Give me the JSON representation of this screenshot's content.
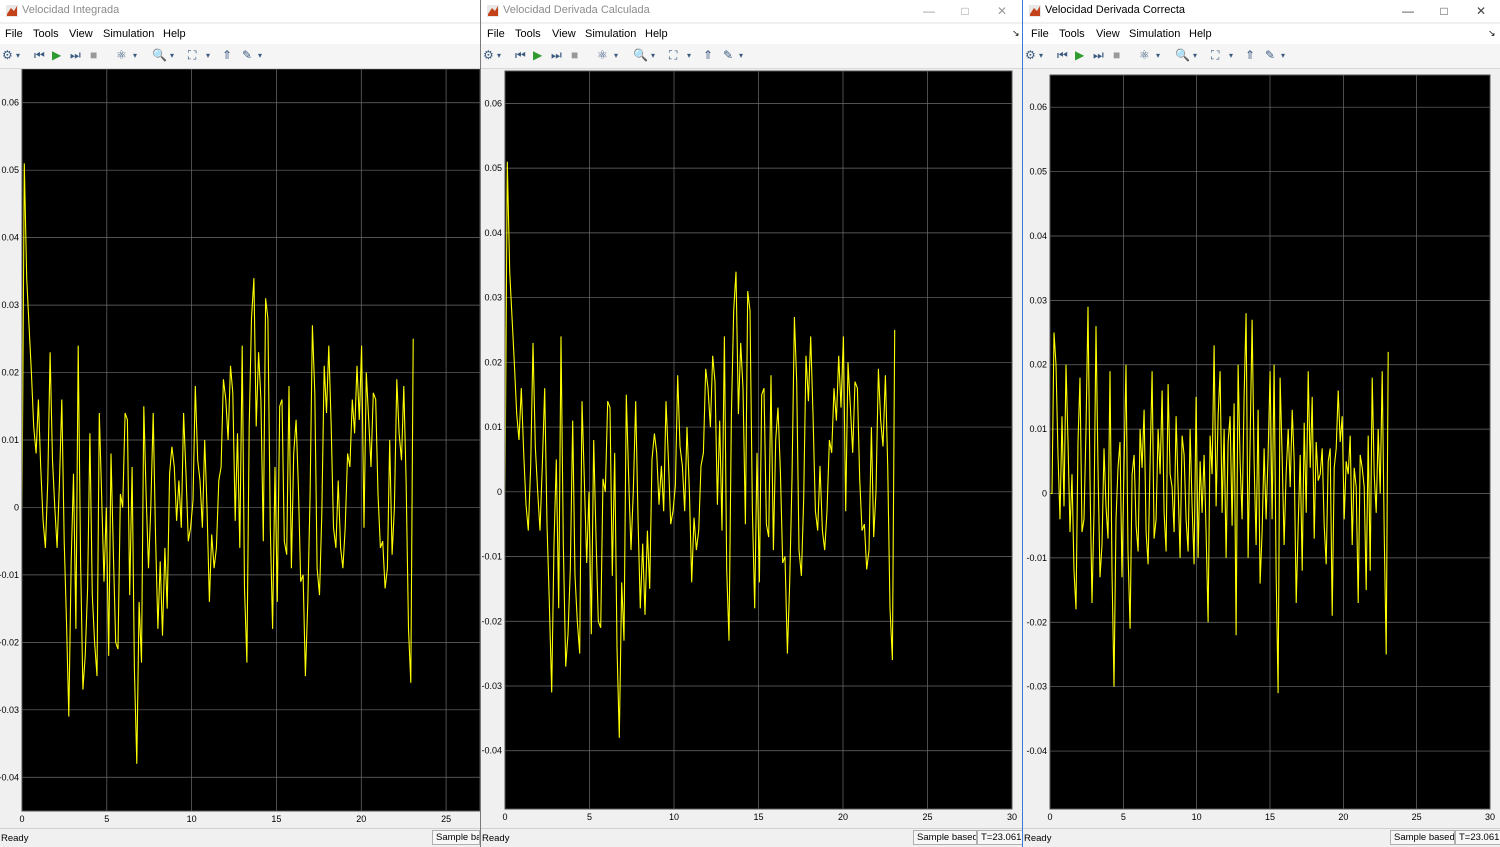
{
  "menu": [
    "File",
    "Tools",
    "View",
    "Simulation",
    "Help"
  ],
  "windows": [
    {
      "title": "Velocidad Integrada",
      "status": "Ready",
      "sample": "Sample based",
      "time": ""
    },
    {
      "title": "Velocidad Derivada Calculada",
      "status": "Ready",
      "sample": "Sample based",
      "time": "T=23.061"
    },
    {
      "title": "Velocidad Derivada Correcta",
      "status": "Ready",
      "sample": "Sample based",
      "time": "T=23.061"
    }
  ],
  "colors": {
    "plot_bg": "#000000",
    "grid": "#6e6e6e",
    "line": "#ffff00",
    "axis_text": "#ffffff"
  },
  "chart_data": [
    {
      "type": "line",
      "ylim": [
        -0.045,
        0.065
      ],
      "xlim": [
        0,
        27
      ],
      "yticks": [
        "-0.04",
        "-0.03",
        "-0.02",
        "-0.01",
        "0",
        "0.01",
        "0.02",
        "0.03",
        "0.04",
        "0.05",
        "0.06"
      ],
      "xticks": [
        "0",
        "5",
        "10",
        "15",
        "20",
        "25"
      ],
      "series": [
        {
          "x_end": 23.06,
          "values": [
            0,
            0.051,
            0.034,
            0.027,
            0.02,
            0.012,
            0.008,
            0.016,
            0.006,
            -0.002,
            -0.006,
            0.004,
            0.023,
            0.007,
            0.0,
            -0.006,
            0.004,
            0.016,
            -0.005,
            -0.017,
            -0.031,
            -0.008,
            0.005,
            -0.018,
            0.024,
            -0.008,
            -0.027,
            -0.022,
            -0.012,
            0.011,
            -0.013,
            -0.02,
            -0.025,
            0.014,
            0.002,
            -0.011,
            0.0,
            -0.022,
            0.008,
            -0.007,
            -0.02,
            -0.021,
            0.002,
            0.0,
            0.014,
            0.013,
            -0.013,
            0.006,
            -0.024,
            -0.038,
            -0.014,
            -0.023,
            0.015,
            0.002,
            -0.009,
            0.0,
            0.014,
            -0.004,
            -0.018,
            -0.008,
            -0.019,
            -0.006,
            -0.015,
            0.005,
            0.009,
            0.006,
            -0.002,
            0.004,
            -0.003,
            0.014,
            0.005,
            -0.005,
            -0.003,
            0.001,
            0.018,
            0.007,
            0.004,
            -0.003,
            0.01,
            0.0,
            -0.014,
            -0.004,
            -0.009,
            -0.006,
            0.004,
            0.006,
            0.019,
            0.016,
            0.01,
            0.021,
            0.017,
            -0.002,
            0.011,
            -0.006,
            0.024,
            -0.012,
            -0.023,
            0.012,
            0.028,
            0.034,
            0.012,
            0.023,
            0.016,
            -0.005,
            0.031,
            0.028,
            -0.003,
            -0.018,
            0.006,
            -0.014,
            0.015,
            0.016,
            -0.005,
            -0.007,
            0.018,
            -0.009,
            0.008,
            0.013,
            0.003,
            -0.011,
            -0.01,
            -0.025,
            -0.014,
            0.002,
            0.027,
            0.017,
            -0.009,
            -0.013,
            -0.001,
            0.021,
            0.014,
            0.024,
            0.012,
            -0.003,
            -0.006,
            0.004,
            -0.006,
            -0.009,
            -0.003,
            0.008,
            0.006,
            0.016,
            0.011,
            0.021,
            0.013,
            0.024,
            -0.003,
            0.02,
            0.013,
            0.006,
            0.017,
            0.016,
            0.002,
            -0.006,
            -0.005,
            -0.012,
            -0.009,
            0.01,
            -0.007,
            0.0,
            0.019,
            0.011,
            0.007,
            0.018,
            0.004,
            -0.018,
            -0.026,
            0.025
          ]
        }
      ]
    },
    {
      "type": "line",
      "ylim": [
        -0.049,
        0.065
      ],
      "xlim": [
        0,
        30
      ],
      "yticks": [
        "-0.04",
        "-0.03",
        "-0.02",
        "-0.01",
        "0",
        "0.01",
        "0.02",
        "0.03",
        "0.04",
        "0.05",
        "0.06"
      ],
      "xticks": [
        "0",
        "5",
        "10",
        "15",
        "20",
        "25",
        "30"
      ],
      "series": [
        {
          "x_end": 23.06,
          "values": [
            0,
            0.051,
            0.034,
            0.027,
            0.02,
            0.012,
            0.008,
            0.016,
            0.006,
            -0.002,
            -0.006,
            0.004,
            0.023,
            0.007,
            0.0,
            -0.006,
            0.004,
            0.016,
            -0.005,
            -0.017,
            -0.031,
            -0.008,
            0.005,
            -0.018,
            0.024,
            -0.008,
            -0.027,
            -0.022,
            -0.012,
            0.011,
            -0.013,
            -0.02,
            -0.025,
            0.014,
            0.002,
            -0.011,
            0.0,
            -0.022,
            0.008,
            -0.007,
            -0.02,
            -0.021,
            0.002,
            0.0,
            0.014,
            0.013,
            -0.013,
            0.006,
            -0.024,
            -0.038,
            -0.014,
            -0.023,
            0.015,
            0.002,
            -0.009,
            0.0,
            0.014,
            -0.004,
            -0.018,
            -0.008,
            -0.019,
            -0.006,
            -0.015,
            0.005,
            0.009,
            0.006,
            -0.002,
            0.004,
            -0.003,
            0.014,
            0.005,
            -0.005,
            -0.003,
            0.001,
            0.018,
            0.007,
            0.004,
            -0.003,
            0.01,
            0.0,
            -0.014,
            -0.004,
            -0.009,
            -0.006,
            0.004,
            0.006,
            0.019,
            0.016,
            0.01,
            0.021,
            0.017,
            -0.002,
            0.011,
            -0.006,
            0.024,
            -0.012,
            -0.023,
            0.012,
            0.028,
            0.034,
            0.012,
            0.023,
            0.016,
            -0.005,
            0.031,
            0.028,
            -0.003,
            -0.018,
            0.006,
            -0.014,
            0.015,
            0.016,
            -0.005,
            -0.007,
            0.018,
            -0.009,
            0.008,
            0.013,
            0.003,
            -0.011,
            -0.01,
            -0.025,
            -0.014,
            0.002,
            0.027,
            0.017,
            -0.009,
            -0.013,
            -0.001,
            0.021,
            0.014,
            0.024,
            0.012,
            -0.003,
            -0.006,
            0.004,
            -0.006,
            -0.009,
            -0.003,
            0.008,
            0.006,
            0.016,
            0.011,
            0.021,
            0.013,
            0.024,
            -0.003,
            0.02,
            0.013,
            0.006,
            0.017,
            0.016,
            0.002,
            -0.006,
            -0.005,
            -0.012,
            -0.009,
            0.01,
            -0.007,
            0.0,
            0.019,
            0.011,
            0.007,
            0.018,
            0.004,
            -0.018,
            -0.026,
            0.025
          ]
        }
      ]
    },
    {
      "type": "line",
      "ylim": [
        -0.049,
        0.065
      ],
      "xlim": [
        0,
        30
      ],
      "yticks": [
        "-0.04",
        "-0.03",
        "-0.02",
        "-0.01",
        "0",
        "0.01",
        "0.02",
        "0.03",
        "0.04",
        "0.05",
        "0.06"
      ],
      "xticks": [
        "0",
        "5",
        "10",
        "15",
        "20",
        "25",
        "30"
      ],
      "series": [
        {
          "x_end": 23.06,
          "values": [
            0,
            0.0,
            0.025,
            0.02,
            0.006,
            -0.004,
            0.012,
            -0.002,
            0.02,
            0.008,
            -0.006,
            0.003,
            -0.012,
            -0.018,
            0.008,
            0.018,
            -0.006,
            -0.004,
            0.01,
            0.029,
            0.002,
            -0.017,
            -0.003,
            0.026,
            0.004,
            -0.013,
            -0.008,
            0.007,
            -0.002,
            -0.007,
            0.019,
            -0.012,
            -0.03,
            -0.004,
            0.004,
            0.008,
            -0.013,
            0.004,
            0.02,
            -0.009,
            -0.021,
            0.003,
            0.006,
            -0.005,
            -0.009,
            0.01,
            0.004,
            0.013,
            -0.006,
            -0.011,
            0.005,
            0.019,
            -0.007,
            -0.004,
            0.01,
            0.003,
            0.016,
            -0.003,
            -0.009,
            0.017,
            0.003,
            0.001,
            -0.006,
            0.012,
            0.001,
            -0.01,
            0.009,
            0.006,
            -0.004,
            -0.009,
            0.01,
            -0.002,
            -0.011,
            0.015,
            -0.01,
            0.005,
            -0.003,
            0.006,
            -0.006,
            -0.02,
            0.009,
            0.003,
            0.023,
            -0.002,
            0.012,
            0.019,
            -0.003,
            0.01,
            -0.01,
            0.008,
            0.012,
            -0.005,
            0.014,
            -0.022,
            0.02,
            0.005,
            -0.004,
            0.015,
            0.028,
            -0.01,
            0.008,
            0.027,
            0.005,
            -0.008,
            0.013,
            -0.014,
            -0.006,
            0.007,
            -0.004,
            0.006,
            0.019,
            -0.004,
            0.02,
            -0.012,
            -0.031,
            0.018,
            0.006,
            -0.008,
            0.003,
            0.01,
            0.001,
            0.013,
            0.005,
            -0.017,
            -0.005,
            0.006,
            -0.012,
            0.011,
            -0.003,
            0.019,
            0.004,
            0.015,
            -0.007,
            0.008,
            0.002,
            0.003,
            0.007,
            -0.005,
            -0.011,
            0.005,
            0.007,
            -0.019,
            0.004,
            0.007,
            0.016,
            0.008,
            0.012,
            -0.004,
            0.005,
            0.003,
            0.009,
            -0.008,
            0.004,
            0.001,
            -0.017,
            0.006,
            0.004,
            0.001,
            -0.015,
            0.009,
            -0.012,
            0.018,
            0.003,
            -0.003,
            0.01,
            0.0,
            0.019,
            -0.006,
            -0.025,
            0.022
          ]
        }
      ]
    }
  ]
}
